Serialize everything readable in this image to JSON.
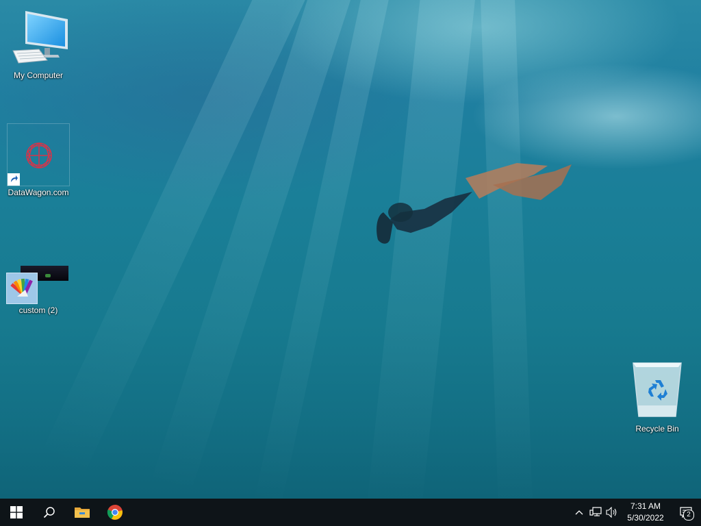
{
  "desktop": {
    "icons": [
      {
        "label": "My Computer",
        "icon": "computer-icon"
      },
      {
        "label": "DataWagon.com",
        "icon": "datawagon-shortcut-icon"
      },
      {
        "label": "custom (2)",
        "icon": "color-fan-image-icon"
      },
      {
        "label": "Recycle Bin",
        "icon": "recycle-bin-icon"
      }
    ],
    "wallpaper": "underwater-freediver"
  },
  "taskbar": {
    "start": "windows-start-icon",
    "search": "search-icon",
    "pinned": [
      "file-explorer-icon",
      "chrome-icon"
    ],
    "tray": {
      "icons": [
        "chevron-up-icon",
        "network-icon",
        "volume-icon"
      ],
      "time": "7:31 AM",
      "date": "5/30/2022",
      "notifications_count": "2"
    }
  },
  "colors": {
    "taskbar": "#0e1418",
    "water": "#1a7f98",
    "explorer_folder": "#f2c14e",
    "recycle_arrows": "#1e7fd4"
  }
}
